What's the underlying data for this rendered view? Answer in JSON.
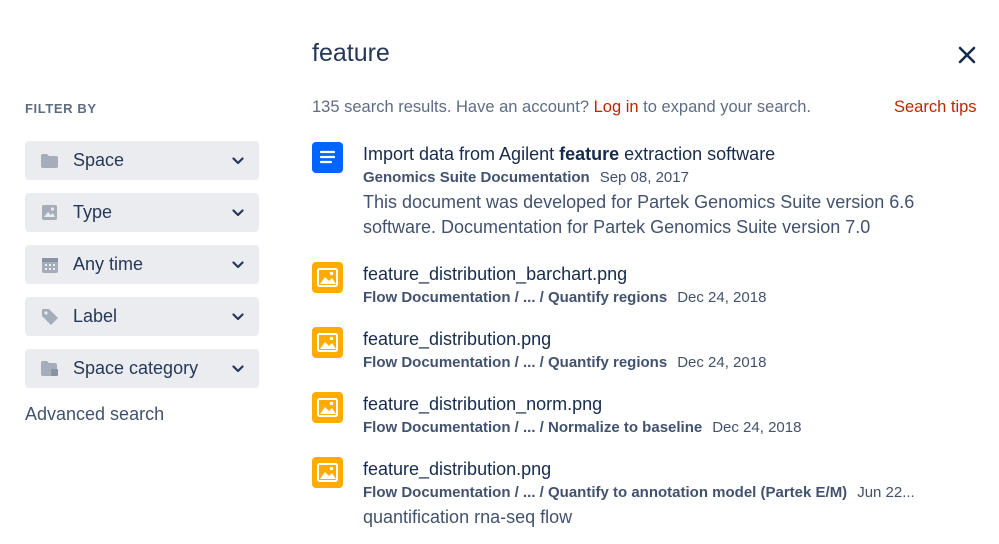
{
  "search": {
    "query": "feature",
    "close_icon": "close-icon"
  },
  "filters": {
    "heading": "FILTER BY",
    "items": [
      {
        "label": "Space",
        "icon": "folder-icon"
      },
      {
        "label": "Type",
        "icon": "image-icon"
      },
      {
        "label": "Any time",
        "icon": "calendar-icon"
      },
      {
        "label": "Label",
        "icon": "tag-icon"
      },
      {
        "label": "Space category",
        "icon": "folder-category-icon"
      }
    ],
    "advanced_search": "Advanced search"
  },
  "summary": {
    "prefix": "135 search results. Have an account? ",
    "login": "Log in",
    "suffix": " to expand your search.",
    "search_tips": "Search tips"
  },
  "results": [
    {
      "icon": "document-icon",
      "title_before": "Import data from Agilent ",
      "title_bold": "feature",
      "title_after": " extraction software",
      "path": "Genomics Suite Documentation",
      "date": "Sep 08, 2017",
      "excerpt": "This document was developed for Partek Genomics Suite version 6.6 software. Documentation for Partek Genomics Suite version 7.0"
    },
    {
      "icon": "image-file-icon",
      "title": "feature_distribution_barchart.png",
      "path": "Flow Documentation / ... / Quantify regions",
      "date": "Dec 24, 2018"
    },
    {
      "icon": "image-file-icon",
      "title": "feature_distribution.png",
      "path": "Flow Documentation / ... / Quantify regions",
      "date": "Dec 24, 2018"
    },
    {
      "icon": "image-file-icon",
      "title": "feature_distribution_norm.png",
      "path": "Flow Documentation / ... / Normalize to baseline",
      "date": "Dec 24, 2018"
    },
    {
      "icon": "image-file-icon",
      "title": "feature_distribution.png",
      "path": "Flow Documentation / ... / Quantify to annotation model (Partek E/M)",
      "date": "Jun 22...",
      "excerpt": "quantification rna-seq flow"
    }
  ],
  "colors": {
    "doc_icon": "#0065ff",
    "image_icon": "#ffab00",
    "link_red": "#bf2600",
    "filter_bg": "#ebecf0"
  }
}
